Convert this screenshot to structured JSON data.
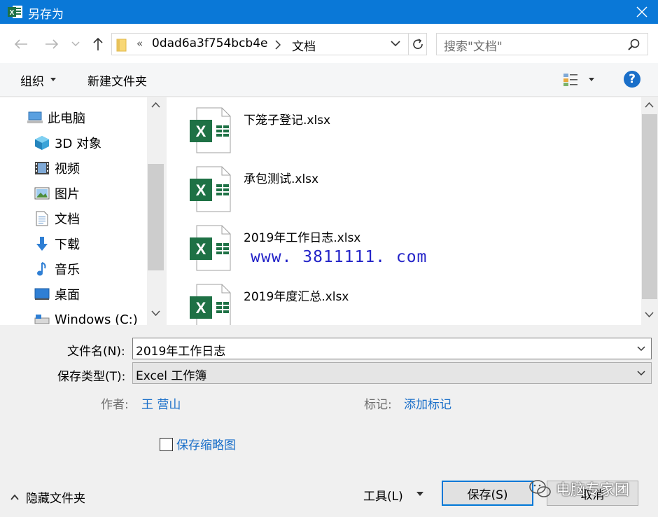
{
  "window": {
    "title": "另存为"
  },
  "address": {
    "overflow": "«",
    "crumbs": [
      "0dad6a3f754bcb4e",
      "文档"
    ]
  },
  "search": {
    "placeholder": "搜索\"文档\""
  },
  "toolbar": {
    "organize": "组织",
    "new_folder": "新建文件夹",
    "help": "?"
  },
  "nav": {
    "items": [
      {
        "label": "此电脑",
        "icon": "computer-icon"
      },
      {
        "label": "3D 对象",
        "icon": "3d-objects-icon"
      },
      {
        "label": "视频",
        "icon": "video-icon"
      },
      {
        "label": "图片",
        "icon": "pictures-icon"
      },
      {
        "label": "文档",
        "icon": "documents-icon"
      },
      {
        "label": "下载",
        "icon": "download-icon"
      },
      {
        "label": "音乐",
        "icon": "music-icon"
      },
      {
        "label": "桌面",
        "icon": "desktop-icon"
      },
      {
        "label": "Windows (C:)",
        "icon": "drive-icon"
      }
    ]
  },
  "files": [
    {
      "name": "下笼子登记.xlsx",
      "icon": "excel-file-icon"
    },
    {
      "name": "承包测试.xlsx",
      "icon": "excel-file-icon"
    },
    {
      "name": "2019年工作日志.xlsx",
      "icon": "excel-file-icon"
    },
    {
      "name": "2019年度汇总.xlsx",
      "icon": "excel-file-icon"
    }
  ],
  "watermark": "www. 3811111. com",
  "form": {
    "filename_label": "文件名(N):",
    "filename_value": "2019年工作日志",
    "filetype_label": "保存类型(T):",
    "filetype_value": "Excel 工作簿",
    "author_label": "作者:",
    "author_value": "王 营山",
    "tags_label": "标记:",
    "tags_value": "添加标记",
    "thumbnail_label": "保存缩略图"
  },
  "footer": {
    "hide_folders": "隐藏文件夹",
    "tools": "工具(L)",
    "save": "保存(S)",
    "cancel": "取消",
    "wechat_overlay": "电脑专家团"
  },
  "colors": {
    "titlebar": "#0a78d7",
    "link": "#1a6fc9",
    "excel_green": "#1e7145",
    "watermark": "#2424c8"
  }
}
